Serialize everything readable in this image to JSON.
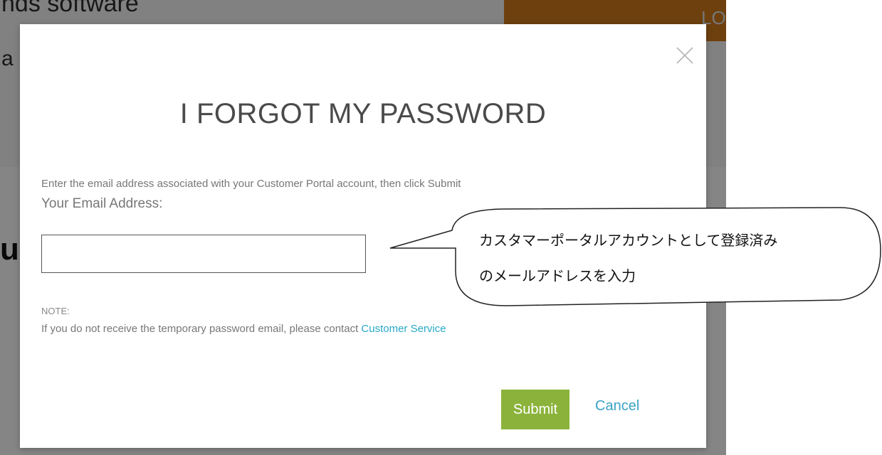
{
  "background": {
    "title_partial": "nds software",
    "subtitle_partial": "a",
    "logout_partial": "LOG",
    "big_letter": "u"
  },
  "modal": {
    "title": "I FORGOT MY PASSWORD",
    "instructions": "Enter the email address associated with your Customer Portal account, then click Submit",
    "email_label": "Your Email Address:",
    "email_value": "",
    "email_placeholder": "",
    "note_label": "NOTE:",
    "note_text": "If you do not receive the temporary password email, please contact ",
    "note_link": "Customer Service",
    "submit_label": "Submit",
    "cancel_label": "Cancel",
    "close_icon": "close-icon"
  },
  "callout": {
    "line1": "カスタマーポータルアカウントとして登録済み",
    "line2": "のメールアドレスを入力"
  },
  "colors": {
    "submit": "#8bb33b",
    "link": "#29a9c8",
    "cancel": "#3aa3c6",
    "background_accent": "#c9761a"
  }
}
